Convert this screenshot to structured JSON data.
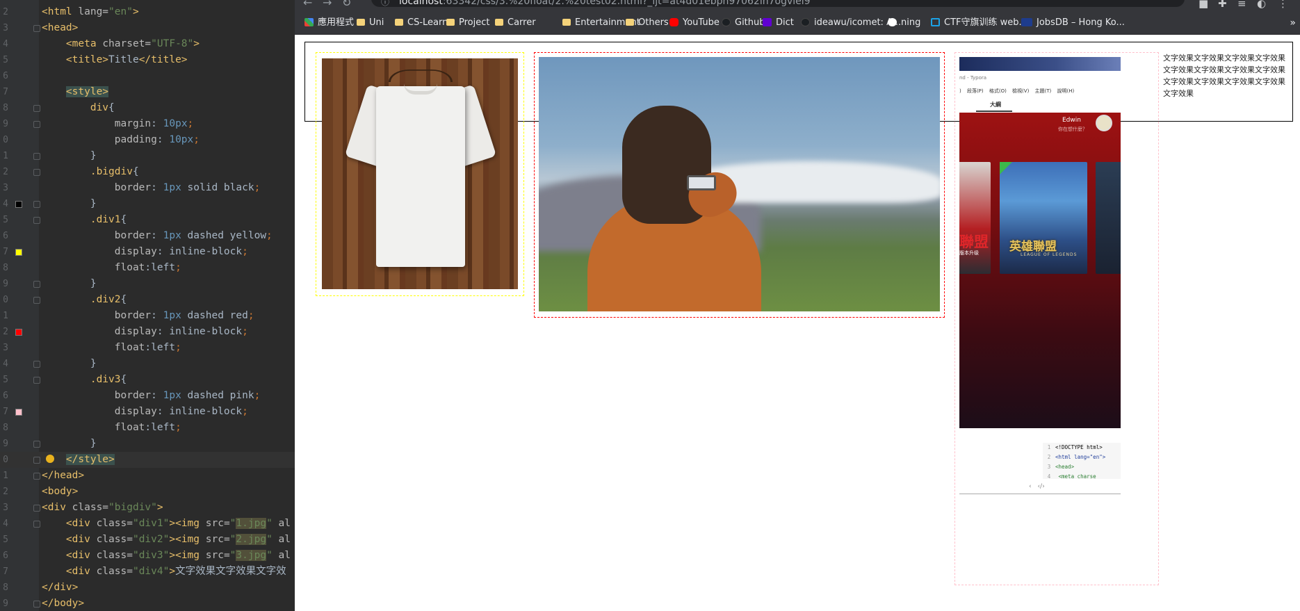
{
  "editor": {
    "lines": [
      {
        "n": "2",
        "code": [
          [
            "t-tag",
            "<html "
          ],
          [
            "t-attr",
            "lang="
          ],
          [
            "t-val",
            "\"en\""
          ],
          [
            "t-tag",
            ">"
          ]
        ]
      },
      {
        "n": "3",
        "code": [
          [
            "t-tag",
            "<head>"
          ]
        ]
      },
      {
        "n": "4",
        "code": [
          [
            "",
            "    "
          ],
          [
            "t-tag",
            "<meta "
          ],
          [
            "t-attr",
            "charset="
          ],
          [
            "t-val",
            "\"UTF-8\""
          ],
          [
            "t-tag",
            ">"
          ]
        ]
      },
      {
        "n": "5",
        "code": [
          [
            "",
            "    "
          ],
          [
            "t-tag",
            "<title>"
          ],
          [
            "",
            "Title"
          ],
          [
            "t-tag",
            "</title>"
          ]
        ]
      },
      {
        "n": "6",
        "code": []
      },
      {
        "n": "7",
        "code": [
          [
            "",
            "    "
          ],
          [
            "t-tag t-hl",
            "<style>"
          ]
        ]
      },
      {
        "n": "8",
        "code": [
          [
            "",
            "        "
          ],
          [
            "t-sel",
            "div"
          ],
          [
            "",
            "{"
          ]
        ]
      },
      {
        "n": "9",
        "code": [
          [
            "",
            "            "
          ],
          [
            "t-prop",
            "margin"
          ],
          [
            "",
            ": "
          ],
          [
            "t-num",
            "10px"
          ],
          [
            "t-kw",
            ";"
          ]
        ]
      },
      {
        "n": "0",
        "code": [
          [
            "",
            "            "
          ],
          [
            "t-prop",
            "padding"
          ],
          [
            "",
            ": "
          ],
          [
            "t-num",
            "10px"
          ],
          [
            "t-kw",
            ";"
          ]
        ]
      },
      {
        "n": "1",
        "code": [
          [
            "",
            "        }"
          ]
        ]
      },
      {
        "n": "2",
        "code": [
          [
            "",
            "        "
          ],
          [
            "t-sel",
            ".bigdiv"
          ],
          [
            "",
            "{"
          ]
        ]
      },
      {
        "n": "3",
        "code": [
          [
            "",
            "            "
          ],
          [
            "t-prop",
            "border"
          ],
          [
            "",
            ": "
          ],
          [
            "t-num",
            "1px"
          ],
          [
            "",
            " solid black"
          ],
          [
            "t-kw",
            ";"
          ]
        ]
      },
      {
        "n": "4",
        "code": [
          [
            "",
            "        }"
          ]
        ]
      },
      {
        "n": "5",
        "code": [
          [
            "",
            "        "
          ],
          [
            "t-sel",
            ".div1"
          ],
          [
            "",
            "{"
          ]
        ]
      },
      {
        "n": "6",
        "code": [
          [
            "",
            "            "
          ],
          [
            "t-prop",
            "border"
          ],
          [
            "",
            ": "
          ],
          [
            "t-num",
            "1px"
          ],
          [
            "",
            " dashed yellow"
          ],
          [
            "t-kw",
            ";"
          ]
        ]
      },
      {
        "n": "7",
        "code": [
          [
            "",
            "            "
          ],
          [
            "t-prop",
            "display"
          ],
          [
            "",
            ": inline-block"
          ],
          [
            "t-kw",
            ";"
          ]
        ]
      },
      {
        "n": "8",
        "code": [
          [
            "",
            "            "
          ],
          [
            "t-prop",
            "float"
          ],
          [
            "",
            ":left"
          ],
          [
            "t-kw",
            ";"
          ]
        ]
      },
      {
        "n": "9",
        "code": [
          [
            "",
            "        }"
          ]
        ]
      },
      {
        "n": "0",
        "code": [
          [
            "",
            "        "
          ],
          [
            "t-sel",
            ".div2"
          ],
          [
            "",
            "{"
          ]
        ]
      },
      {
        "n": "1",
        "code": [
          [
            "",
            "            "
          ],
          [
            "t-prop",
            "border"
          ],
          [
            "",
            ": "
          ],
          [
            "t-num",
            "1px"
          ],
          [
            "",
            " dashed red"
          ],
          [
            "t-kw",
            ";"
          ]
        ]
      },
      {
        "n": "2",
        "code": [
          [
            "",
            "            "
          ],
          [
            "t-prop",
            "display"
          ],
          [
            "",
            ": inline-block"
          ],
          [
            "t-kw",
            ";"
          ]
        ]
      },
      {
        "n": "3",
        "code": [
          [
            "",
            "            "
          ],
          [
            "t-prop",
            "float"
          ],
          [
            "",
            ":left"
          ],
          [
            "t-kw",
            ";"
          ]
        ]
      },
      {
        "n": "4",
        "code": [
          [
            "",
            "        }"
          ]
        ]
      },
      {
        "n": "5",
        "code": [
          [
            "",
            "        "
          ],
          [
            "t-sel",
            ".div3"
          ],
          [
            "",
            "{"
          ]
        ]
      },
      {
        "n": "6",
        "code": [
          [
            "",
            "            "
          ],
          [
            "t-prop",
            "border"
          ],
          [
            "",
            ": "
          ],
          [
            "t-num",
            "1px"
          ],
          [
            "",
            " dashed pink"
          ],
          [
            "t-kw",
            ";"
          ]
        ]
      },
      {
        "n": "7",
        "code": [
          [
            "",
            "            "
          ],
          [
            "t-prop",
            "display"
          ],
          [
            "",
            ": inline-block"
          ],
          [
            "t-kw",
            ";"
          ]
        ]
      },
      {
        "n": "8",
        "code": [
          [
            "",
            "            "
          ],
          [
            "t-prop",
            "float"
          ],
          [
            "",
            ":left"
          ],
          [
            "t-kw",
            ";"
          ]
        ]
      },
      {
        "n": "9",
        "code": [
          [
            "",
            "        }"
          ]
        ]
      },
      {
        "n": "0",
        "code": [
          [
            "",
            "    "
          ],
          [
            "t-tag t-hl",
            "</style>"
          ]
        ]
      },
      {
        "n": "1",
        "code": [
          [
            "t-tag",
            "</head>"
          ]
        ]
      },
      {
        "n": "2",
        "code": [
          [
            "t-tag",
            "<body>"
          ]
        ]
      },
      {
        "n": "3",
        "code": [
          [
            "t-tag",
            "<div "
          ],
          [
            "t-attr",
            "class="
          ],
          [
            "t-val",
            "\"bigdiv\""
          ],
          [
            "t-tag",
            ">"
          ]
        ]
      },
      {
        "n": "4",
        "code": [
          [
            "",
            "    "
          ],
          [
            "t-tag",
            "<div "
          ],
          [
            "t-attr",
            "class="
          ],
          [
            "t-val",
            "\"div1\""
          ],
          [
            "t-tag",
            "><img "
          ],
          [
            "t-attr",
            "src="
          ],
          [
            "t-val",
            "\""
          ],
          [
            "t-valhl",
            "1.jpg"
          ],
          [
            "t-val",
            "\""
          ],
          [
            "t-attr",
            " al"
          ]
        ]
      },
      {
        "n": "5",
        "code": [
          [
            "",
            "    "
          ],
          [
            "t-tag",
            "<div "
          ],
          [
            "t-attr",
            "class="
          ],
          [
            "t-val",
            "\"div2\""
          ],
          [
            "t-tag",
            "><img "
          ],
          [
            "t-attr",
            "src="
          ],
          [
            "t-val",
            "\""
          ],
          [
            "t-valhl",
            "2.jpg"
          ],
          [
            "t-val",
            "\""
          ],
          [
            "t-attr",
            " al"
          ]
        ]
      },
      {
        "n": "6",
        "code": [
          [
            "",
            "    "
          ],
          [
            "t-tag",
            "<div "
          ],
          [
            "t-attr",
            "class="
          ],
          [
            "t-val",
            "\"div3\""
          ],
          [
            "t-tag",
            "><img "
          ],
          [
            "t-attr",
            "src="
          ],
          [
            "t-val",
            "\""
          ],
          [
            "t-valhl",
            "3.jpg"
          ],
          [
            "t-val",
            "\""
          ],
          [
            "t-attr",
            " al"
          ]
        ]
      },
      {
        "n": "7",
        "code": [
          [
            "",
            "    "
          ],
          [
            "t-tag",
            "<div "
          ],
          [
            "t-attr",
            "class="
          ],
          [
            "t-val",
            "\"div4\""
          ],
          [
            "t-tag",
            ">"
          ],
          [
            "",
            "文字效果文字效果文字效"
          ]
        ]
      },
      {
        "n": "8",
        "code": [
          [
            "t-tag",
            "</div>"
          ]
        ]
      },
      {
        "n": "9",
        "code": [
          [
            "t-tag",
            "</body>"
          ]
        ]
      }
    ],
    "swatch_colors": {
      "12": "#000000",
      "15": "#ffff00",
      "20": "#ff0000",
      "25": "#ffc0cb"
    }
  },
  "browser": {
    "url_host": "localhost",
    "url_rest": ":63342/css/3.%20float/2.%20test02.html?_ijt=at4d01ebpn97062in7ogvlel9",
    "bookmarks": [
      {
        "label": "應用程式",
        "icon": "apps-icon"
      },
      {
        "label": "Uni",
        "icon": "folder-icon"
      },
      {
        "label": "CS-Learn",
        "icon": "folder-icon"
      },
      {
        "label": "Project",
        "icon": "folder-icon"
      },
      {
        "label": "Carrer",
        "icon": "folder-icon"
      },
      {
        "label": "Entertainment",
        "icon": "folder-icon"
      },
      {
        "label": "Others",
        "icon": "folder-icon"
      },
      {
        "label": "YouTube",
        "icon": "youtube-icon"
      },
      {
        "label": "Github",
        "icon": "github-icon"
      },
      {
        "label": "Dict",
        "icon": "yahoo-icon"
      },
      {
        "label": "ideawu/icomet: A...",
        "icon": "github-icon"
      },
      {
        "label": "ning",
        "icon": "globe-icon"
      },
      {
        "label": "CTF守旗训练 web...",
        "icon": "ctf-icon"
      },
      {
        "label": "JobsDB – Hong Ko...",
        "icon": "jobsdb-icon"
      }
    ],
    "more_glyph": "»"
  },
  "page": {
    "div4_text": "文字效果文字效果文字效果文字效果文字效果文字效果文字效果文字效果文字效果文字效果文字效果文字效果文字效果",
    "shot": {
      "title": "nd - Typora",
      "menu": ") 段落(P) 格式(O) 檢視(V) 主題(T) 說明(H)",
      "tab": "大綱",
      "user": "Edwin",
      "status": "你在想什麼？",
      "card_left_text": "聯盟",
      "card_left_sub": "版本升级",
      "game_title": "英雄聯盟",
      "game_sub": "LEAGUE OF LEGENDS",
      "code_lines": [
        {
          "n": "1",
          "text": "<!DOCTYPE html>"
        },
        {
          "n": "2",
          "text": "<html lang=\"en\">"
        },
        {
          "n": "3",
          "text": "<head>"
        },
        {
          "n": "4",
          "text": "    <meta charse"
        }
      ],
      "nav": "‹ ‹/›"
    }
  }
}
